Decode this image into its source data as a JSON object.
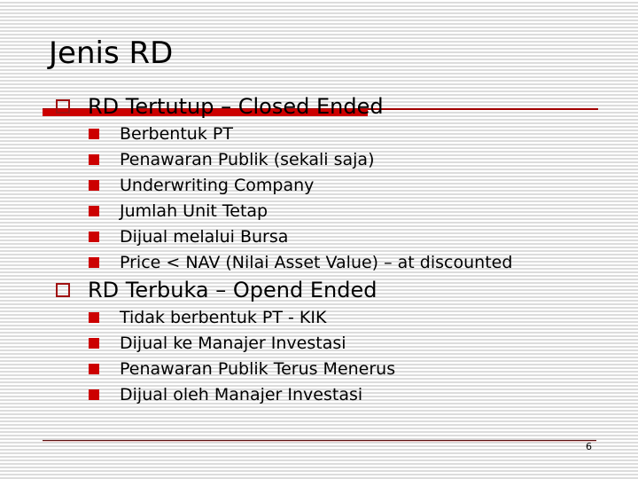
{
  "slide": {
    "title": "Jenis RD",
    "page_number": "6",
    "colors": {
      "accent": "#cc0000",
      "bullet_outline": "#a01010",
      "footer_line": "#5a1010",
      "stripe": "#dcdcdc"
    },
    "sections": [
      {
        "heading": "RD Tertutup – Closed Ended",
        "bullet_icon": "hollow-square",
        "items": [
          "Berbentuk PT",
          "Penawaran Publik (sekali saja)",
          "Underwriting Company",
          "Jumlah Unit Tetap",
          "Dijual melalui Bursa",
          "Price < NAV (Nilai Asset Value) – at discounted"
        ]
      },
      {
        "heading": "RD Terbuka – Opend Ended",
        "bullet_icon": "hollow-square",
        "items": [
          "Tidak berbentuk PT - KIK",
          "Dijual ke Manajer Investasi",
          "Penawaran Publik Terus Menerus",
          "Dijual oleh Manajer Investasi"
        ]
      }
    ],
    "sub_bullet_icon": "filled-square"
  }
}
